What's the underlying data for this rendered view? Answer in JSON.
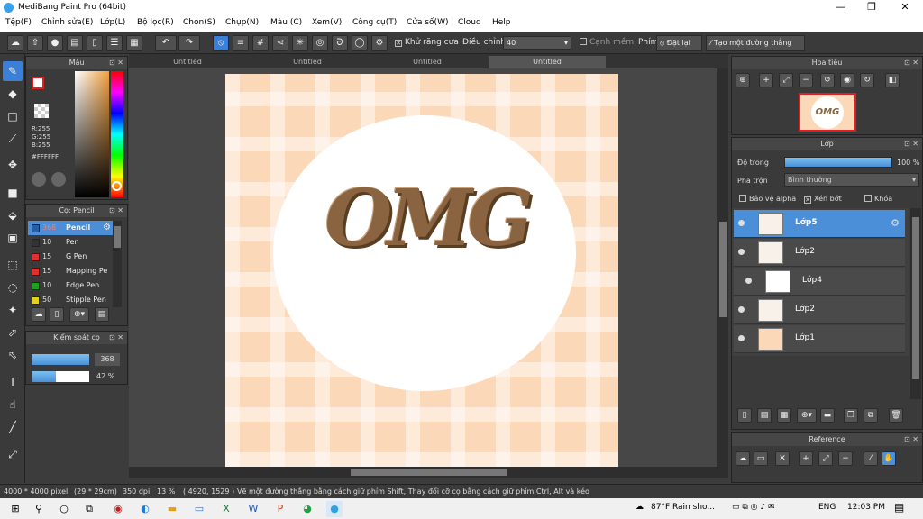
{
  "window": {
    "title": "MediBang Paint Pro (64bit)",
    "minimize": "—",
    "restore": "❐",
    "close": "✕"
  },
  "menu": [
    "Tệp(F)",
    "Chỉnh sửa(E)",
    "Lớp(L)",
    "Bộ lọc(R)",
    "Chọn(S)",
    "Chụp(N)",
    "Màu (C)",
    "Xem(V)",
    "Công cụ(T)",
    "Cửa số(W)",
    "Cloud",
    "Help"
  ],
  "toolbar": {
    "antialias": "Khử răng cưa",
    "adjust": "Điều chỉnh",
    "adjust_value": "40",
    "edge": "Cạnh mềm",
    "key": "Phím",
    "reset": "Đặt lại",
    "straight_line": "Tạo một đường thẳng"
  },
  "tabs": [
    "Untitled",
    "Untitled",
    "Untitled",
    "Untitled"
  ],
  "color_panel": {
    "title": "Màu",
    "r": "R:255",
    "g": "G:255",
    "b": "B:255",
    "hex": "#FFFFFF"
  },
  "brush_panel": {
    "title": "Cọ: Pencil",
    "brushes": [
      {
        "size": "368",
        "name": "Pencil",
        "color": "#2b5ea0"
      },
      {
        "size": "10",
        "name": "Pen",
        "color": "#333333"
      },
      {
        "size": "15",
        "name": "G Pen",
        "color": "#e03030"
      },
      {
        "size": "15",
        "name": "Mapping Pe",
        "color": "#e03030"
      },
      {
        "size": "10",
        "name": "Edge Pen",
        "color": "#20a020"
      },
      {
        "size": "50",
        "name": "Stipple Pen",
        "color": "#e0d020"
      }
    ]
  },
  "control_panel": {
    "title": "Kiểm soát cọ",
    "size": "368",
    "opacity": "42 %",
    "opacity_fraction": 0.42
  },
  "canvas": {
    "text": "OMG"
  },
  "navigator": {
    "title": "Hoa tiêu"
  },
  "layer_panel": {
    "title": "Lớp",
    "opacity_label": "Độ trong",
    "opacity_value": "100 %",
    "blend_label": "Pha trộn",
    "blend_value": "Bình thường",
    "protect_alpha": "Bảo vệ alpha",
    "clipping": "Xén bớt",
    "lock": "Khóa",
    "layers": [
      "Lớp5",
      "Lớp2",
      "Lớp4",
      "Lớp2",
      "Lớp1"
    ]
  },
  "reference_panel": {
    "title": "Reference"
  },
  "status": {
    "size": "4000 * 4000 pixel",
    "cm": "(29 * 29cm)",
    "dpi": "350 dpi",
    "zoom": "13 %",
    "coords": "( 4920, 1529 )",
    "hint": "Vẽ một đường thẳng bằng cách giữ phím Shift, Thay đổi cỡ cọ bằng cách giữ phím Ctrl, Alt và kéo"
  },
  "taskbar": {
    "weather": "87°F  Rain sho...",
    "lang": "ENG",
    "time": "12:03 PM"
  },
  "colors": {
    "accent": "#3c7fd6",
    "canvas_bg": "#fbd9b8",
    "letter": "#8a6440"
  }
}
